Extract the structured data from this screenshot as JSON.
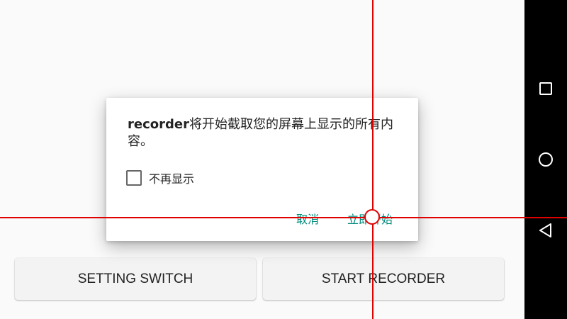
{
  "buttons": {
    "setting_switch": "SETTING SWITCH",
    "start_recorder": "START RECORDER"
  },
  "dialog": {
    "app_name": "recorder",
    "message_rest": "将开始截取您的屏幕上显示的所有内容。",
    "checkbox_label": "不再显示",
    "checkbox_checked": false,
    "cancel_label": "取消",
    "start_label": "立即开始",
    "accent_color": "#00897b"
  },
  "navbar": {
    "icons": [
      "recents-icon",
      "home-icon",
      "back-icon"
    ]
  },
  "overlay": {
    "crosshair_color": "#e00000"
  }
}
